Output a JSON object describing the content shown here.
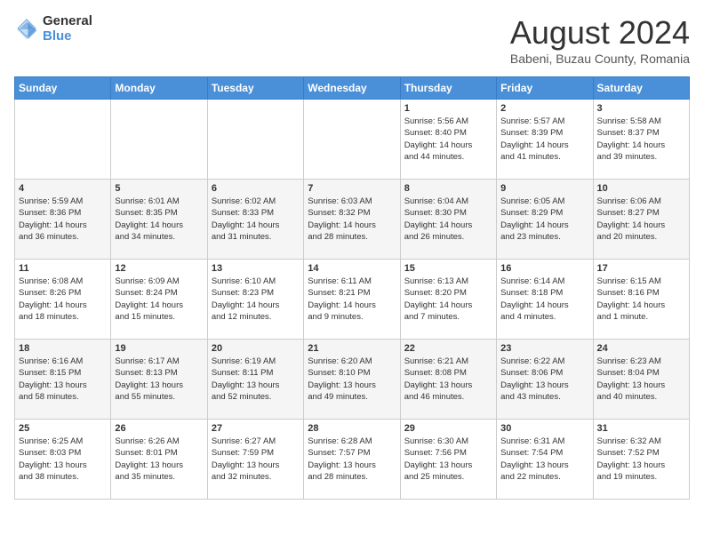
{
  "header": {
    "logo_general": "General",
    "logo_blue": "Blue",
    "month_year": "August 2024",
    "location": "Babeni, Buzau County, Romania"
  },
  "days_of_week": [
    "Sunday",
    "Monday",
    "Tuesday",
    "Wednesday",
    "Thursday",
    "Friday",
    "Saturday"
  ],
  "weeks": [
    [
      {
        "day": "",
        "info": ""
      },
      {
        "day": "",
        "info": ""
      },
      {
        "day": "",
        "info": ""
      },
      {
        "day": "",
        "info": ""
      },
      {
        "day": "1",
        "info": "Sunrise: 5:56 AM\nSunset: 8:40 PM\nDaylight: 14 hours\nand 44 minutes."
      },
      {
        "day": "2",
        "info": "Sunrise: 5:57 AM\nSunset: 8:39 PM\nDaylight: 14 hours\nand 41 minutes."
      },
      {
        "day": "3",
        "info": "Sunrise: 5:58 AM\nSunset: 8:37 PM\nDaylight: 14 hours\nand 39 minutes."
      }
    ],
    [
      {
        "day": "4",
        "info": "Sunrise: 5:59 AM\nSunset: 8:36 PM\nDaylight: 14 hours\nand 36 minutes."
      },
      {
        "day": "5",
        "info": "Sunrise: 6:01 AM\nSunset: 8:35 PM\nDaylight: 14 hours\nand 34 minutes."
      },
      {
        "day": "6",
        "info": "Sunrise: 6:02 AM\nSunset: 8:33 PM\nDaylight: 14 hours\nand 31 minutes."
      },
      {
        "day": "7",
        "info": "Sunrise: 6:03 AM\nSunset: 8:32 PM\nDaylight: 14 hours\nand 28 minutes."
      },
      {
        "day": "8",
        "info": "Sunrise: 6:04 AM\nSunset: 8:30 PM\nDaylight: 14 hours\nand 26 minutes."
      },
      {
        "day": "9",
        "info": "Sunrise: 6:05 AM\nSunset: 8:29 PM\nDaylight: 14 hours\nand 23 minutes."
      },
      {
        "day": "10",
        "info": "Sunrise: 6:06 AM\nSunset: 8:27 PM\nDaylight: 14 hours\nand 20 minutes."
      }
    ],
    [
      {
        "day": "11",
        "info": "Sunrise: 6:08 AM\nSunset: 8:26 PM\nDaylight: 14 hours\nand 18 minutes."
      },
      {
        "day": "12",
        "info": "Sunrise: 6:09 AM\nSunset: 8:24 PM\nDaylight: 14 hours\nand 15 minutes."
      },
      {
        "day": "13",
        "info": "Sunrise: 6:10 AM\nSunset: 8:23 PM\nDaylight: 14 hours\nand 12 minutes."
      },
      {
        "day": "14",
        "info": "Sunrise: 6:11 AM\nSunset: 8:21 PM\nDaylight: 14 hours\nand 9 minutes."
      },
      {
        "day": "15",
        "info": "Sunrise: 6:13 AM\nSunset: 8:20 PM\nDaylight: 14 hours\nand 7 minutes."
      },
      {
        "day": "16",
        "info": "Sunrise: 6:14 AM\nSunset: 8:18 PM\nDaylight: 14 hours\nand 4 minutes."
      },
      {
        "day": "17",
        "info": "Sunrise: 6:15 AM\nSunset: 8:16 PM\nDaylight: 14 hours\nand 1 minute."
      }
    ],
    [
      {
        "day": "18",
        "info": "Sunrise: 6:16 AM\nSunset: 8:15 PM\nDaylight: 13 hours\nand 58 minutes."
      },
      {
        "day": "19",
        "info": "Sunrise: 6:17 AM\nSunset: 8:13 PM\nDaylight: 13 hours\nand 55 minutes."
      },
      {
        "day": "20",
        "info": "Sunrise: 6:19 AM\nSunset: 8:11 PM\nDaylight: 13 hours\nand 52 minutes."
      },
      {
        "day": "21",
        "info": "Sunrise: 6:20 AM\nSunset: 8:10 PM\nDaylight: 13 hours\nand 49 minutes."
      },
      {
        "day": "22",
        "info": "Sunrise: 6:21 AM\nSunset: 8:08 PM\nDaylight: 13 hours\nand 46 minutes."
      },
      {
        "day": "23",
        "info": "Sunrise: 6:22 AM\nSunset: 8:06 PM\nDaylight: 13 hours\nand 43 minutes."
      },
      {
        "day": "24",
        "info": "Sunrise: 6:23 AM\nSunset: 8:04 PM\nDaylight: 13 hours\nand 40 minutes."
      }
    ],
    [
      {
        "day": "25",
        "info": "Sunrise: 6:25 AM\nSunset: 8:03 PM\nDaylight: 13 hours\nand 38 minutes."
      },
      {
        "day": "26",
        "info": "Sunrise: 6:26 AM\nSunset: 8:01 PM\nDaylight: 13 hours\nand 35 minutes."
      },
      {
        "day": "27",
        "info": "Sunrise: 6:27 AM\nSunset: 7:59 PM\nDaylight: 13 hours\nand 32 minutes."
      },
      {
        "day": "28",
        "info": "Sunrise: 6:28 AM\nSunset: 7:57 PM\nDaylight: 13 hours\nand 28 minutes."
      },
      {
        "day": "29",
        "info": "Sunrise: 6:30 AM\nSunset: 7:56 PM\nDaylight: 13 hours\nand 25 minutes."
      },
      {
        "day": "30",
        "info": "Sunrise: 6:31 AM\nSunset: 7:54 PM\nDaylight: 13 hours\nand 22 minutes."
      },
      {
        "day": "31",
        "info": "Sunrise: 6:32 AM\nSunset: 7:52 PM\nDaylight: 13 hours\nand 19 minutes."
      }
    ]
  ]
}
